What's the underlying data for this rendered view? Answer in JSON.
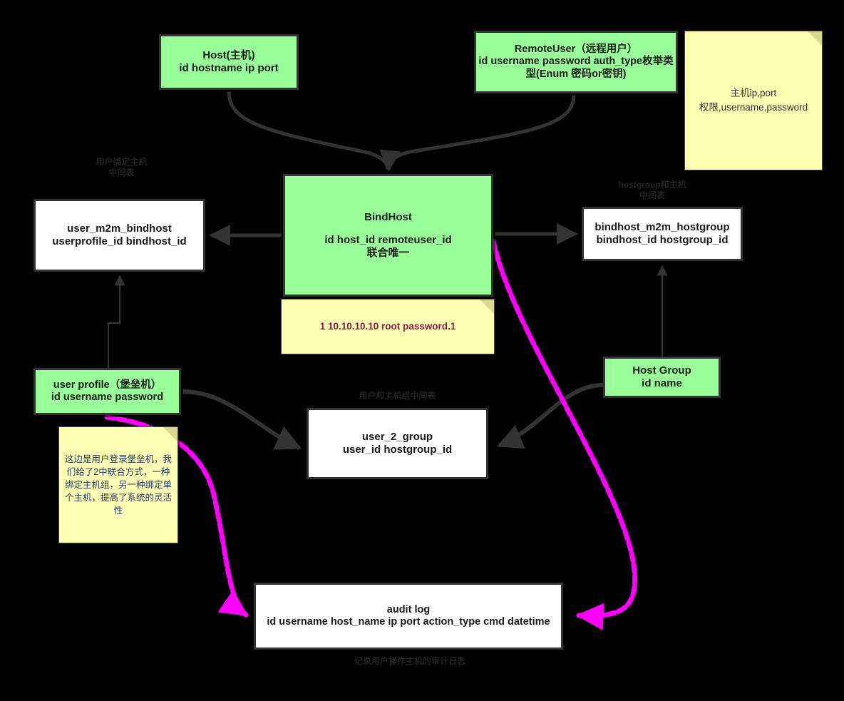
{
  "diagram": {
    "type": "er-diagram",
    "background_color": "#000000",
    "palette": {
      "entity_fill": "#99ff99",
      "join_table_fill": "#ffffff",
      "note_fill": "#ffffb3",
      "edge_color": "#333333",
      "highlight_edge_color": "#ff00ff",
      "note_accent_text": "#8b1a4a",
      "note_blue_text": "#1f3864"
    },
    "nodes": [
      {
        "id": "host",
        "kind": "entity",
        "fill": "#99ff99",
        "lines": [
          "Host(主机)",
          "id  hostname ip port"
        ]
      },
      {
        "id": "remoteuser",
        "kind": "entity",
        "fill": "#99ff99",
        "lines": [
          "RemoteUser（远程用户）",
          "id  username password auth_type枚举类型(Enum 密码or密钥)"
        ]
      },
      {
        "id": "bindhost",
        "kind": "entity",
        "fill": "#99ff99",
        "lines": [
          "BindHost",
          "id host_id remoteuser_id",
          "联合唯一"
        ]
      },
      {
        "id": "user_m2m_bindhost",
        "kind": "join-table",
        "fill": "#ffffff",
        "lines": [
          "user_m2m_bindhost",
          "userprofile_id bindhost_id"
        ]
      },
      {
        "id": "bindhost_m2m_hostgroup",
        "kind": "join-table",
        "fill": "#ffffff",
        "lines": [
          "bindhost_m2m_hostgroup",
          "bindhost_id  hostgroup_id"
        ]
      },
      {
        "id": "user_profile",
        "kind": "entity",
        "fill": "#99ff99",
        "lines": [
          "user profile（堡垒机）",
          "id username password"
        ]
      },
      {
        "id": "user_2_group",
        "kind": "join-table",
        "fill": "#ffffff",
        "lines": [
          "user_2_group",
          "user_id hostgroup_id"
        ]
      },
      {
        "id": "host_group",
        "kind": "entity",
        "fill": "#99ff99",
        "lines": [
          "Host Group",
          "id name"
        ]
      },
      {
        "id": "audit_log",
        "kind": "join-table",
        "fill": "#ffffff",
        "lines": [
          "audit  log",
          "id username host_name ip port action_type cmd datetime"
        ]
      }
    ],
    "notes": [
      {
        "id": "note-top-right",
        "lines": [
          "主机ip,port",
          "权限,username,password"
        ]
      },
      {
        "id": "note-bindhost-sample",
        "lines": [
          "1 10.10.10.10 root password.1"
        ]
      },
      {
        "id": "note-user-profile",
        "lines": [
          "这边是用户登录堡垒机，我们给了2中联合方式，一种绑定主机组，另一种绑定单个主机，提高了系统的灵活性"
        ]
      }
    ],
    "captions": [
      {
        "id": "caption-left",
        "text": "用户绑定主机\n中间表"
      },
      {
        "id": "caption-right",
        "text": "hostgroup和主机\n中间表"
      },
      {
        "id": "caption-mid",
        "text": "用户和主机组中间表"
      },
      {
        "id": "caption-audit",
        "text": "记录用户操作主机的审计日志"
      }
    ]
  },
  "nodes": {
    "host": {
      "title": "Host(主机)",
      "fields": "id  hostname ip port"
    },
    "remoteuser": {
      "title": "RemoteUser（远程用户）",
      "fields": "id  username password auth_type枚举类型(Enum 密码or密钥)"
    },
    "bindhost": {
      "title": "BindHost",
      "fields": "id host_id remoteuser_id",
      "constraint": "联合唯一"
    },
    "user_m2m_bindhost": {
      "title": "user_m2m_bindhost",
      "fields": "userprofile_id bindhost_id"
    },
    "bindhost_m2m_hostgroup": {
      "title": "bindhost_m2m_hostgroup",
      "fields": "bindhost_id  hostgroup_id"
    },
    "user_profile": {
      "title": "user profile（堡垒机）",
      "fields": "id username password"
    },
    "user_2_group": {
      "title": "user_2_group",
      "fields": "user_id hostgroup_id"
    },
    "host_group": {
      "title": "Host Group",
      "fields": "id name"
    },
    "audit_log": {
      "title": "audit  log",
      "fields": "id username host_name ip port action_type cmd datetime"
    }
  },
  "notes": {
    "top_right": {
      "line1": "主机ip,port",
      "line2": "权限,username,password"
    },
    "bindhost_sample": {
      "text": "1 10.10.10.10 root password.1"
    },
    "user_profile_note": {
      "text": "这边是用户登录堡垒机，我们给了2中联合方式，一种绑定主机组，另一种绑定单个主机，提高了系统的灵活性"
    }
  },
  "captions": {
    "left": "用户绑定主机\n中间表",
    "right": "hostgroup和主机\n中间表",
    "mid": "用户和主机组中间表",
    "audit": "记录用户操作主机的审计日志"
  }
}
